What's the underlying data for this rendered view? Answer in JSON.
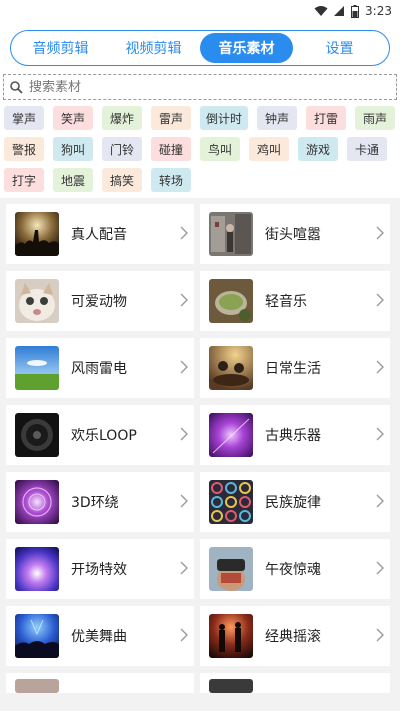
{
  "status_bar": {
    "time": "3:23",
    "icons": [
      "wifi-icon",
      "signal-icon",
      "battery-icon"
    ]
  },
  "tabs": [
    {
      "label": "音频剪辑",
      "active": false
    },
    {
      "label": "视频剪辑",
      "active": false
    },
    {
      "label": "音乐素材",
      "active": true
    },
    {
      "label": "设置",
      "active": false
    }
  ],
  "search": {
    "placeholder": "搜索素材",
    "value": ""
  },
  "tags": [
    {
      "label": "掌声",
      "color": "#e4e6f2"
    },
    {
      "label": "笑声",
      "color": "#fbdedd"
    },
    {
      "label": "爆炸",
      "color": "#e4f2da"
    },
    {
      "label": "雷声",
      "color": "#fbe9dc"
    },
    {
      "label": "倒计时",
      "color": "#cfe9f1"
    },
    {
      "label": "钟声",
      "color": "#e4e6f2"
    },
    {
      "label": "打雷",
      "color": "#fbdedd"
    },
    {
      "label": "雨声",
      "color": "#e4f2da"
    },
    {
      "label": "警报",
      "color": "#fbe9dc"
    },
    {
      "label": "狗叫",
      "color": "#cfe9f1"
    },
    {
      "label": "门铃",
      "color": "#e4e6f2"
    },
    {
      "label": "碰撞",
      "color": "#fbdedd"
    },
    {
      "label": "鸟叫",
      "color": "#e4f2da"
    },
    {
      "label": "鸡叫",
      "color": "#fbe9dc"
    },
    {
      "label": "游戏",
      "color": "#cfe9f1"
    },
    {
      "label": "卡通",
      "color": "#e4e6f2"
    },
    {
      "label": "打字",
      "color": "#fbdedd"
    },
    {
      "label": "地震",
      "color": "#e4f2da"
    },
    {
      "label": "搞笑",
      "color": "#fbe9dc"
    },
    {
      "label": "转场",
      "color": "#cfe9f1"
    }
  ],
  "categories": [
    {
      "label": "真人配音",
      "thumb": "concert-crowd"
    },
    {
      "label": "街头喧嚣",
      "thumb": "street-scene"
    },
    {
      "label": "可爱动物",
      "thumb": "cat"
    },
    {
      "label": "轻音乐",
      "thumb": "tea-bowl"
    },
    {
      "label": "风雨雷电",
      "thumb": "sky-meadow"
    },
    {
      "label": "日常生活",
      "thumb": "dining"
    },
    {
      "label": "欢乐LOOP",
      "thumb": "speaker"
    },
    {
      "label": "古典乐器",
      "thumb": "purple-light"
    },
    {
      "label": "3D环绕",
      "thumb": "purple-swirl"
    },
    {
      "label": "民族旋律",
      "thumb": "pattern"
    },
    {
      "label": "开场特效",
      "thumb": "blue-purple-glow"
    },
    {
      "label": "午夜惊魂",
      "thumb": "vr-headset"
    },
    {
      "label": "优美舞曲",
      "thumb": "dance-stage"
    },
    {
      "label": "经典摇滚",
      "thumb": "rock-band"
    }
  ]
}
